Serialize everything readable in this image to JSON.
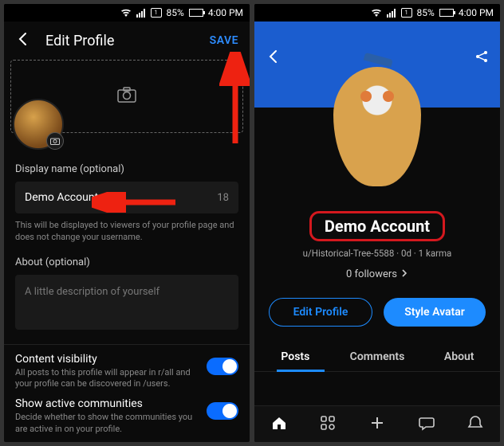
{
  "status": {
    "battery_pct": "85%",
    "time": "4:00 PM"
  },
  "left": {
    "title": "Edit Profile",
    "save": "SAVE",
    "display_name_label": "Display name (optional)",
    "display_name_value": "Demo Account",
    "display_name_remaining": "18",
    "display_name_hint": "This will be displayed to viewers of your profile page and does not change your username.",
    "about_label": "About (optional)",
    "about_placeholder": "A little description of yourself",
    "content_visibility_title": "Content visibility",
    "content_visibility_sub": "All posts to this profile will appear in r/all and your profile can be discovered in /users.",
    "content_visibility_on": true,
    "show_active_title": "Show active communities",
    "show_active_sub": "Decide whether to show the communities you are active in on your profile.",
    "show_active_on": true
  },
  "right": {
    "display_name": "Demo Account",
    "meta": "u/Historical-Tree-5588 · 0d · 1 karma",
    "followers": "0 followers",
    "edit_profile": "Edit Profile",
    "style_avatar": "Style Avatar",
    "tabs": {
      "posts": "Posts",
      "comments": "Comments",
      "about": "About"
    }
  }
}
